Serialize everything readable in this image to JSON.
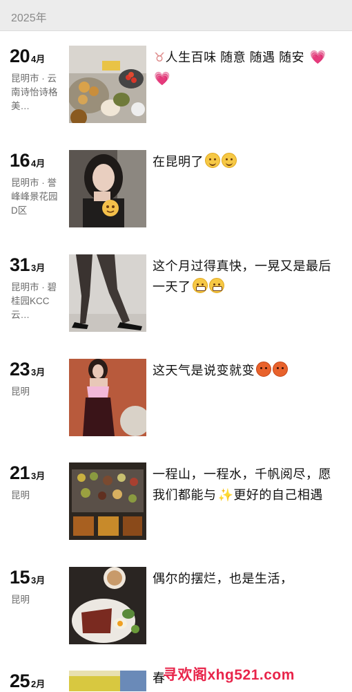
{
  "year": "2025年",
  "posts": [
    {
      "day": "20",
      "month": "4月",
      "location": "昆明市 · 云南诗怡诗格美…",
      "text": "人生百味 随意 随遇 随安",
      "emojis": [
        "heart",
        "heart"
      ],
      "lead_icon": "ox-icon"
    },
    {
      "day": "16",
      "month": "4月",
      "location": "昆明市 · 誉峰峰景花园D区",
      "text": "在昆明了",
      "emojis": [
        "smile",
        "smile"
      ]
    },
    {
      "day": "31",
      "month": "3月",
      "location": "昆明市 · 碧桂园KCC云…",
      "text": "这个月过得真快，一晃又是最后一天了",
      "emojis": [
        "grin",
        "grin"
      ]
    },
    {
      "day": "23",
      "month": "3月",
      "location": "昆明",
      "text": "这天气是说变就变",
      "emojis": [
        "angry",
        "angry"
      ]
    },
    {
      "day": "21",
      "month": "3月",
      "location": "昆明",
      "text_a": "一程山，一程水，千帆阅尽，愿我们都能与",
      "text_b": "更好的自己相遇"
    },
    {
      "day": "15",
      "month": "3月",
      "location": "昆明",
      "text": "偶尔的摆烂，也是生活，"
    },
    {
      "day": "25",
      "month": "2月",
      "location": "",
      "text": "春"
    }
  ],
  "watermark": "寻欢阁xhg521.com"
}
